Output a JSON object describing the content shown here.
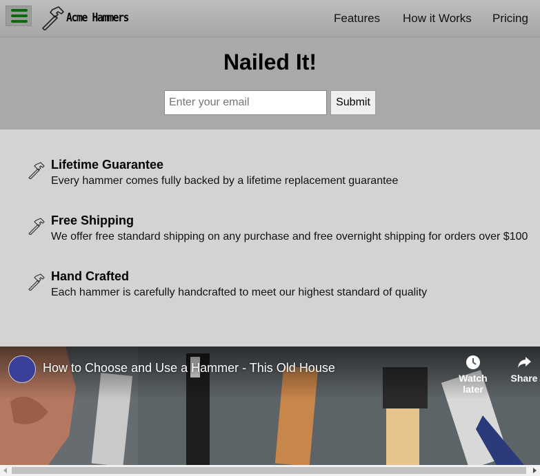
{
  "header": {
    "brand": "Acme Hammers",
    "nav": [
      {
        "label": "Features"
      },
      {
        "label": "How it Works"
      },
      {
        "label": "Pricing"
      }
    ]
  },
  "hero": {
    "title": "Nailed It!",
    "email_placeholder": "Enter your email",
    "submit_label": "Submit"
  },
  "features": [
    {
      "title": "Lifetime Guarantee",
      "desc": "Every hammer comes fully backed by a lifetime replacement guarantee"
    },
    {
      "title": "Free Shipping",
      "desc": "We offer free standard shipping on any purchase and free overnight shipping for orders over $100"
    },
    {
      "title": "Hand Crafted",
      "desc": "Each hammer is carefully handcrafted to meet our highest standard of quality"
    }
  ],
  "video": {
    "title": "How to Choose and Use a Hammer - This Old House",
    "watch_later": "Watch later",
    "share": "Share"
  },
  "colors": {
    "header_bg": "#a9a9a9",
    "page_bg": "#d3d3d3",
    "menu_icon": "#0c6b0c"
  }
}
